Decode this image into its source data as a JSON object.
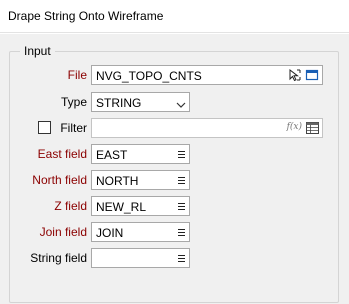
{
  "window": {
    "title": "Drape String Onto Wireframe"
  },
  "input_group": {
    "title": "Input"
  },
  "file": {
    "label": "File",
    "value": "NVG_TOPO_CNTS"
  },
  "type": {
    "label": "Type",
    "value": "STRING"
  },
  "filter": {
    "label": "Filter",
    "checked": false,
    "value": "",
    "fx_label": "f(x)"
  },
  "east_field": {
    "label": "East field",
    "value": "EAST"
  },
  "north_field": {
    "label": "North field",
    "value": "NORTH"
  },
  "z_field": {
    "label": "Z field",
    "value": "NEW_RL"
  },
  "join_field": {
    "label": "Join field",
    "value": "JOIN"
  },
  "string_field": {
    "label": "String field",
    "value": ""
  },
  "colors": {
    "required_label": "#8b0000",
    "accent": "#1a5fb4"
  },
  "icons": {
    "file_pick": "cursor-select-icon",
    "file_browse": "window-browse-icon",
    "type_dropdown": "chevron-down-icon",
    "filter_expression": "function-icon",
    "filter_table": "table-icon",
    "field_list": "list-icon"
  }
}
